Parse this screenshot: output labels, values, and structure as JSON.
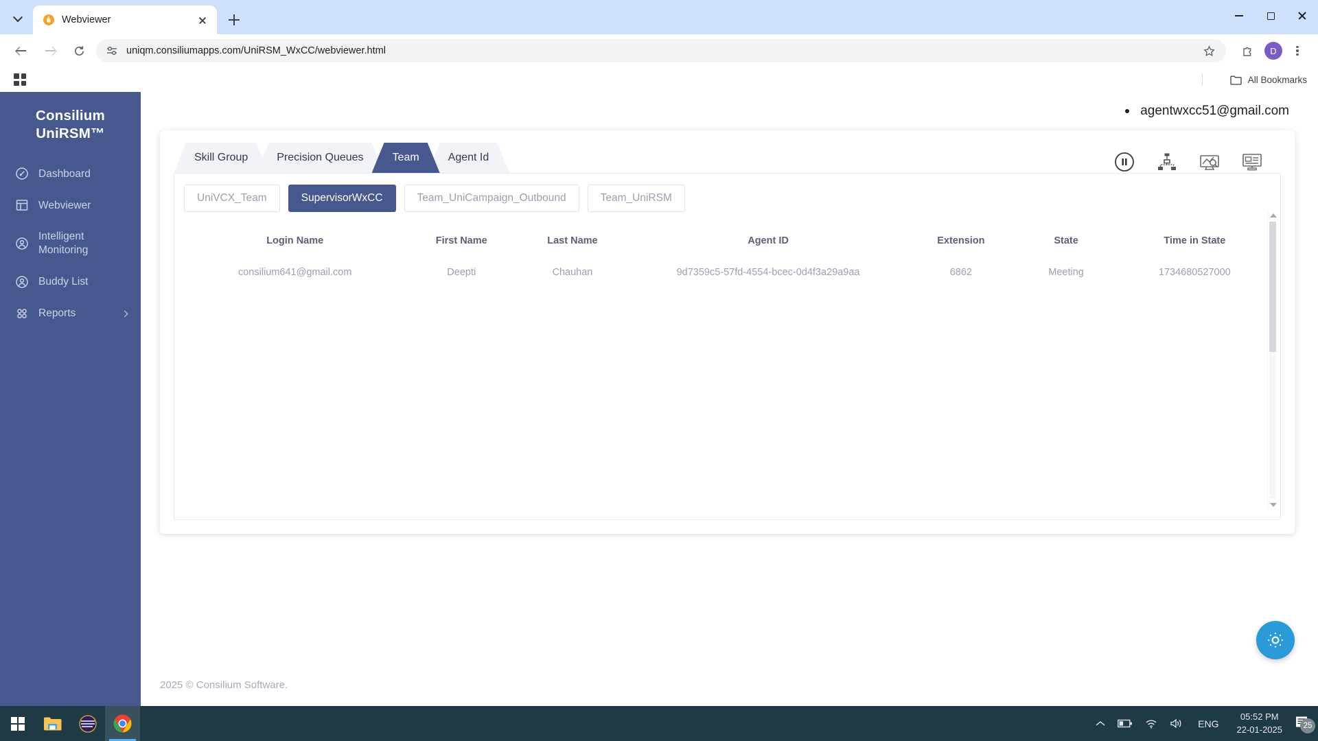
{
  "browser": {
    "tab": {
      "title": "Webviewer",
      "favicon": "flame-icon"
    },
    "new_tab_label": "+",
    "url": "uniqm.consiliumapps.com/UniRSM_WxCC/webviewer.html",
    "bookmarks_label": "All Bookmarks",
    "profile_initial": "D"
  },
  "sidebar": {
    "brand_line1": "Consilium",
    "brand_line2": "UniRSM™",
    "items": [
      {
        "label": "Dashboard",
        "icon": "gauge-icon"
      },
      {
        "label": "Webviewer",
        "icon": "layout-icon"
      },
      {
        "label": "Intelligent Monitoring",
        "icon": "user-circle-icon"
      },
      {
        "label": "Buddy List",
        "icon": "user-circle-icon"
      },
      {
        "label": "Reports",
        "icon": "grid-dots-icon",
        "chevron": true
      }
    ]
  },
  "header": {
    "user_email": "agentwxcc51@gmail.com"
  },
  "main": {
    "tabs": [
      {
        "label": "Skill Group",
        "active": false
      },
      {
        "label": "Precision Queues",
        "active": false
      },
      {
        "label": "Team",
        "active": true
      },
      {
        "label": "Agent Id",
        "active": false
      }
    ],
    "chips": [
      {
        "label": "UniVCX_Team",
        "active": false
      },
      {
        "label": "SupervisorWxCC",
        "active": true
      },
      {
        "label": "Team_UniCampaign_Outbound",
        "active": false
      },
      {
        "label": "Team_UniRSM",
        "active": false
      }
    ],
    "table": {
      "columns": [
        "Login Name",
        "First Name",
        "Last Name",
        "Agent ID",
        "Extension",
        "State",
        "Time in State"
      ],
      "rows": [
        [
          "consilium641@gmail.com",
          "Deepti",
          "Chauhan",
          "9d7359c5-57fd-4554-bcec-0d4f3a29a9aa",
          "6862",
          "Meeting",
          "1734680527000"
        ]
      ]
    },
    "toolbar_icons": [
      "pause-circle-icon",
      "org-hierarchy-icon",
      "monitor-analytics-icon",
      "presentation-screen-icon"
    ],
    "fab_icon": "gear-icon"
  },
  "footer": {
    "copyright": "2025 © Consilium Software."
  },
  "taskbar": {
    "apps": [
      "windows-start-icon",
      "file-explorer-icon",
      "eclipse-icon",
      "chrome-icon"
    ],
    "language": "ENG",
    "time": "05:52 PM",
    "date": "22-01-2025",
    "notification_count": "25"
  },
  "colors": {
    "brand_navy": "#47588f",
    "accent_blue": "#2b9ad9",
    "chrome_blue": "#cfe0fb",
    "taskbar": "#1e3a44"
  }
}
